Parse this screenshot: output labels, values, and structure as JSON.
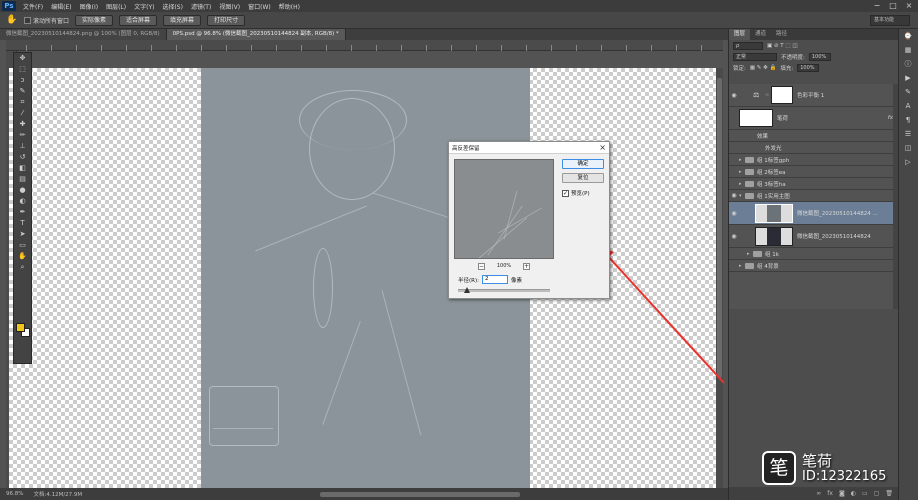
{
  "app": {
    "logo": "Ps",
    "menus": [
      "文件(F)",
      "编辑(E)",
      "图像(I)",
      "图层(L)",
      "文字(Y)",
      "选择(S)",
      "滤镜(T)",
      "视图(V)",
      "窗口(W)",
      "帮助(H)"
    ]
  },
  "options_bar": {
    "scroll_all_windows": "滚动所有窗口",
    "buttons": [
      "实际像素",
      "适合屏幕",
      "填充屏幕",
      "打印尺寸"
    ],
    "workspace": "基本功能"
  },
  "doc_tabs": [
    {
      "label": "微信截图_20230510144824.png @ 100% (图层 0, RGB/8)",
      "active": false
    },
    {
      "label": "0PS.psd @ 96.8% (微信截图_20230510144824 副本, RGB/8) *",
      "active": true
    }
  ],
  "layers_panel": {
    "tabs": [
      "图层",
      "通道",
      "路径"
    ],
    "blend_mode": "正常",
    "opacity_label": "不透明度:",
    "opacity_value": "100%",
    "lock_label": "锁定:",
    "fill_label": "填充:",
    "fill_value": "100%",
    "layers": [
      {
        "name": "色彩平衡 1",
        "kind": "adjustment"
      },
      {
        "name": "笔荷",
        "kind": "white-thumb",
        "fx": "fx"
      },
      {
        "name": "效果",
        "kind": "effect-sub"
      },
      {
        "name": "外发光",
        "kind": "effect-sub2"
      },
      {
        "name": "组 1标签gph",
        "kind": "group"
      },
      {
        "name": "组 2标签ea",
        "kind": "group"
      },
      {
        "name": "组 3标签ha",
        "kind": "group"
      },
      {
        "name": "组 1实用主图",
        "kind": "group-open"
      },
      {
        "name": "微信截图_20230510144824 ...",
        "kind": "photo",
        "selected": true
      },
      {
        "name": "微信截图_20230510144824",
        "kind": "photo"
      },
      {
        "name": "组 1k",
        "kind": "subgroup"
      },
      {
        "name": "组 4背景",
        "kind": "group"
      }
    ]
  },
  "status_bar": {
    "zoom": "96.8%",
    "doc_info": "文档:4.12M/27.9M"
  },
  "high_pass_dialog": {
    "title": "高反差保留",
    "ok_label": "确定",
    "reset_label": "复位",
    "preview_label": "预览(P)",
    "preview_checked": "✓",
    "zoom_label": "100%",
    "radius_label": "半径(R):",
    "radius_value": "2",
    "radius_unit": "像素",
    "radius_slider_fraction": 0.1
  },
  "watermark": {
    "logo_glyph": "笔",
    "name": "笔荷",
    "id": "ID:12322165"
  },
  "colors": {
    "foreground": "#f0c419",
    "background": "#ffffff",
    "arrow": "#e8322d",
    "selected_layer": "#6c7e96"
  },
  "icons": {
    "tools": [
      "move-tool-icon",
      "marquee-tool-icon",
      "lasso-tool-icon",
      "quick-select-tool-icon",
      "crop-tool-icon",
      "eyedropper-tool-icon",
      "healing-brush-tool-icon",
      "brush-tool-icon",
      "clone-stamp-tool-icon",
      "history-brush-tool-icon",
      "eraser-tool-icon",
      "gradient-tool-icon",
      "blur-tool-icon",
      "dodge-tool-icon",
      "pen-tool-icon",
      "type-tool-icon",
      "path-select-tool-icon",
      "shape-tool-icon",
      "hand-tool-icon",
      "zoom-tool-icon"
    ]
  }
}
